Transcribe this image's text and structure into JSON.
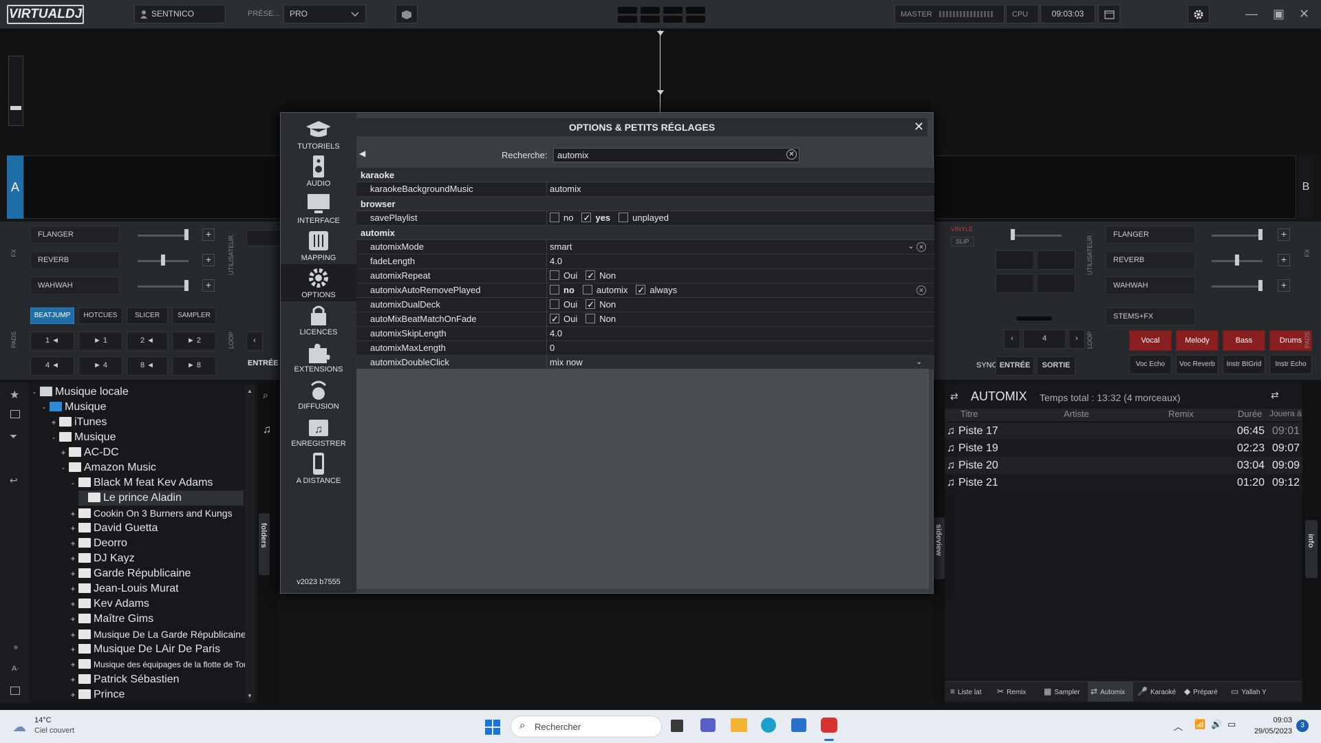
{
  "app": {
    "logo": "VIRTUALDJ",
    "user": "SENTNICO",
    "preset_label": "PRÉSE...",
    "preset_value": "PRO",
    "master_label": "MASTER",
    "cpu_label": "CPU",
    "clock": "09:03:03"
  },
  "decks": {
    "left_letter": "A",
    "right_letter": "B",
    "fx_left": [
      "FLANGER",
      "REVERB",
      "WAHWAH"
    ],
    "fx_right": [
      "FLANGER",
      "REVERB",
      "WAHWAH"
    ],
    "fx_label": "FX",
    "user_label": "UTILISATEUR",
    "loop_label": "LOOP",
    "pads_label": "PADS",
    "pad_modes": [
      "BEATJUMP",
      "HOTCUES",
      "SLICER",
      "SAMPLER"
    ],
    "beatjump_pads": [
      "1 ◄",
      "► 1",
      "2 ◄",
      "► 2",
      "4 ◄",
      "► 4",
      "8 ◄",
      "► 8"
    ],
    "entree_left": "ENTRÉE",
    "loop_value": "4",
    "entree": "ENTRÉE",
    "sortie": "SORTIE",
    "sync": "SYNC",
    "vinyl": "VINYLE",
    "slip": "SLIP",
    "stems_fx": "STEMS+FX",
    "stems": [
      "Vocal",
      "Melody",
      "Bass",
      "Drums"
    ],
    "stems2": [
      "Voc Echo",
      "Voc Reverb",
      "Instr BtGrid",
      "Instr Echo"
    ]
  },
  "browser": {
    "tree": [
      {
        "label": "Musique locale",
        "exp": "-",
        "indent": 0,
        "icon": "pc"
      },
      {
        "label": "Musique",
        "exp": "-",
        "indent": 1,
        "icon": "blue"
      },
      {
        "label": "iTunes",
        "exp": "+",
        "indent": 2,
        "icon": "folder"
      },
      {
        "label": "Musique",
        "exp": "-",
        "indent": 2,
        "icon": "folder"
      },
      {
        "label": "AC-DC",
        "exp": "+",
        "indent": 3,
        "icon": "folder"
      },
      {
        "label": "Amazon Music",
        "exp": "-",
        "indent": 3,
        "icon": "folder"
      },
      {
        "label": "Black M feat Kev Adams",
        "exp": "-",
        "indent": 4,
        "icon": "folder"
      },
      {
        "label": "Le prince Aladin",
        "exp": "",
        "indent": 5,
        "icon": "folder",
        "selected": true
      },
      {
        "label": "Cookin On 3 Burners and Kungs",
        "exp": "+",
        "indent": 4,
        "icon": "folder"
      },
      {
        "label": "David Guetta",
        "exp": "+",
        "indent": 4,
        "icon": "folder"
      },
      {
        "label": "Deorro",
        "exp": "+",
        "indent": 4,
        "icon": "folder"
      },
      {
        "label": "DJ Kayz",
        "exp": "+",
        "indent": 4,
        "icon": "folder"
      },
      {
        "label": "Garde Républicaine",
        "exp": "+",
        "indent": 4,
        "icon": "folder"
      },
      {
        "label": "Jean-Louis Murat",
        "exp": "+",
        "indent": 4,
        "icon": "folder"
      },
      {
        "label": "Kev Adams",
        "exp": "+",
        "indent": 4,
        "icon": "folder"
      },
      {
        "label": "Maître Gims",
        "exp": "+",
        "indent": 4,
        "icon": "folder"
      },
      {
        "label": "Musique De La Garde Républicaine",
        "exp": "+",
        "indent": 4,
        "icon": "folder"
      },
      {
        "label": "Musique De LAir De Paris",
        "exp": "+",
        "indent": 4,
        "icon": "folder"
      },
      {
        "label": "Musique des équipages de la flotte de Toulo",
        "exp": "+",
        "indent": 4,
        "icon": "folder"
      },
      {
        "label": "Patrick Sébastien",
        "exp": "+",
        "indent": 4,
        "icon": "folder"
      },
      {
        "label": "Prince",
        "exp": "+",
        "indent": 4,
        "icon": "folder"
      }
    ],
    "folders_tab": "folders",
    "sideview_tab": "sideview",
    "info_tab": "info"
  },
  "dialog": {
    "title": "OPTIONS & PETITS RÉGLAGES",
    "search_label": "Recherche:",
    "search_value": "automix",
    "sidebar": [
      "TUTORIELS",
      "AUDIO",
      "INTERFACE",
      "MAPPING",
      "OPTIONS",
      "LICENCES",
      "EXTENSIONS",
      "DIFFUSION",
      "ENREGISTRER",
      "A DISTANCE"
    ],
    "version": "v2023 b7555",
    "categories": [
      {
        "name": "karaoke",
        "rows": [
          {
            "key": "karaokeBackgroundMusic",
            "type": "text",
            "value": "automix"
          }
        ]
      },
      {
        "name": "browser",
        "rows": [
          {
            "key": "savePlaylist",
            "type": "checks",
            "options": [
              {
                "label": "no",
                "on": false
              },
              {
                "label": "yes",
                "on": true,
                "bold": true
              },
              {
                "label": "unplayed",
                "on": false
              }
            ]
          }
        ]
      },
      {
        "name": "automix",
        "rows": [
          {
            "key": "automixMode",
            "type": "select",
            "value": "smart",
            "reset": true
          },
          {
            "key": "fadeLength",
            "type": "text",
            "value": "4.0"
          },
          {
            "key": "automixRepeat",
            "type": "checks",
            "options": [
              {
                "label": "Oui",
                "on": false
              },
              {
                "label": "Non",
                "on": true
              }
            ]
          },
          {
            "key": "automixAutoRemovePlayed",
            "type": "checks",
            "options": [
              {
                "label": "no",
                "on": false,
                "bold": true
              },
              {
                "label": "automix",
                "on": false
              },
              {
                "label": "always",
                "on": true
              }
            ],
            "reset": true
          },
          {
            "key": "automixDualDeck",
            "type": "checks",
            "options": [
              {
                "label": "Oui",
                "on": false
              },
              {
                "label": "Non",
                "on": true
              }
            ]
          },
          {
            "key": "autoMixBeatMatchOnFade",
            "type": "checks",
            "options": [
              {
                "label": "Oui",
                "on": true
              },
              {
                "label": "Non",
                "on": false
              }
            ]
          },
          {
            "key": "automixSkipLength",
            "type": "text",
            "value": "4.0"
          },
          {
            "key": "automixMaxLength",
            "type": "text",
            "value": "0"
          },
          {
            "key": "automixDoubleClick",
            "type": "select",
            "value": "mix now",
            "selected": true
          }
        ]
      }
    ]
  },
  "automix": {
    "title": "AUTOMIX",
    "total": "Temps total : 13:32 (4 morceaux)",
    "columns": [
      "Titre",
      "Artiste",
      "Remix",
      "Durée",
      "Jouera à"
    ],
    "rows": [
      {
        "title": "Piste 17",
        "duration": "06:45",
        "plays_at": "09:01"
      },
      {
        "title": "Piste 19",
        "duration": "02:23",
        "plays_at": "09:07"
      },
      {
        "title": "Piste 20",
        "duration": "03:04",
        "plays_at": "09:09"
      },
      {
        "title": "Piste 21",
        "duration": "01:20",
        "plays_at": "09:12"
      }
    ],
    "bottom_tabs": [
      "Liste lat",
      "Remix",
      "Sampler",
      "Automix",
      "Karaoké",
      "Préparé",
      "Yallah Y"
    ]
  },
  "taskbar": {
    "temp": "14°C",
    "weather": "Ciel couvert",
    "search_placeholder": "Rechercher",
    "time": "09:03",
    "date": "29/05/2023",
    "notif": "3"
  },
  "colors": {
    "accent_blue": "#1f6ea8",
    "stem_red": "#8a1f1f",
    "dialog_bg": "#3a3d42"
  }
}
